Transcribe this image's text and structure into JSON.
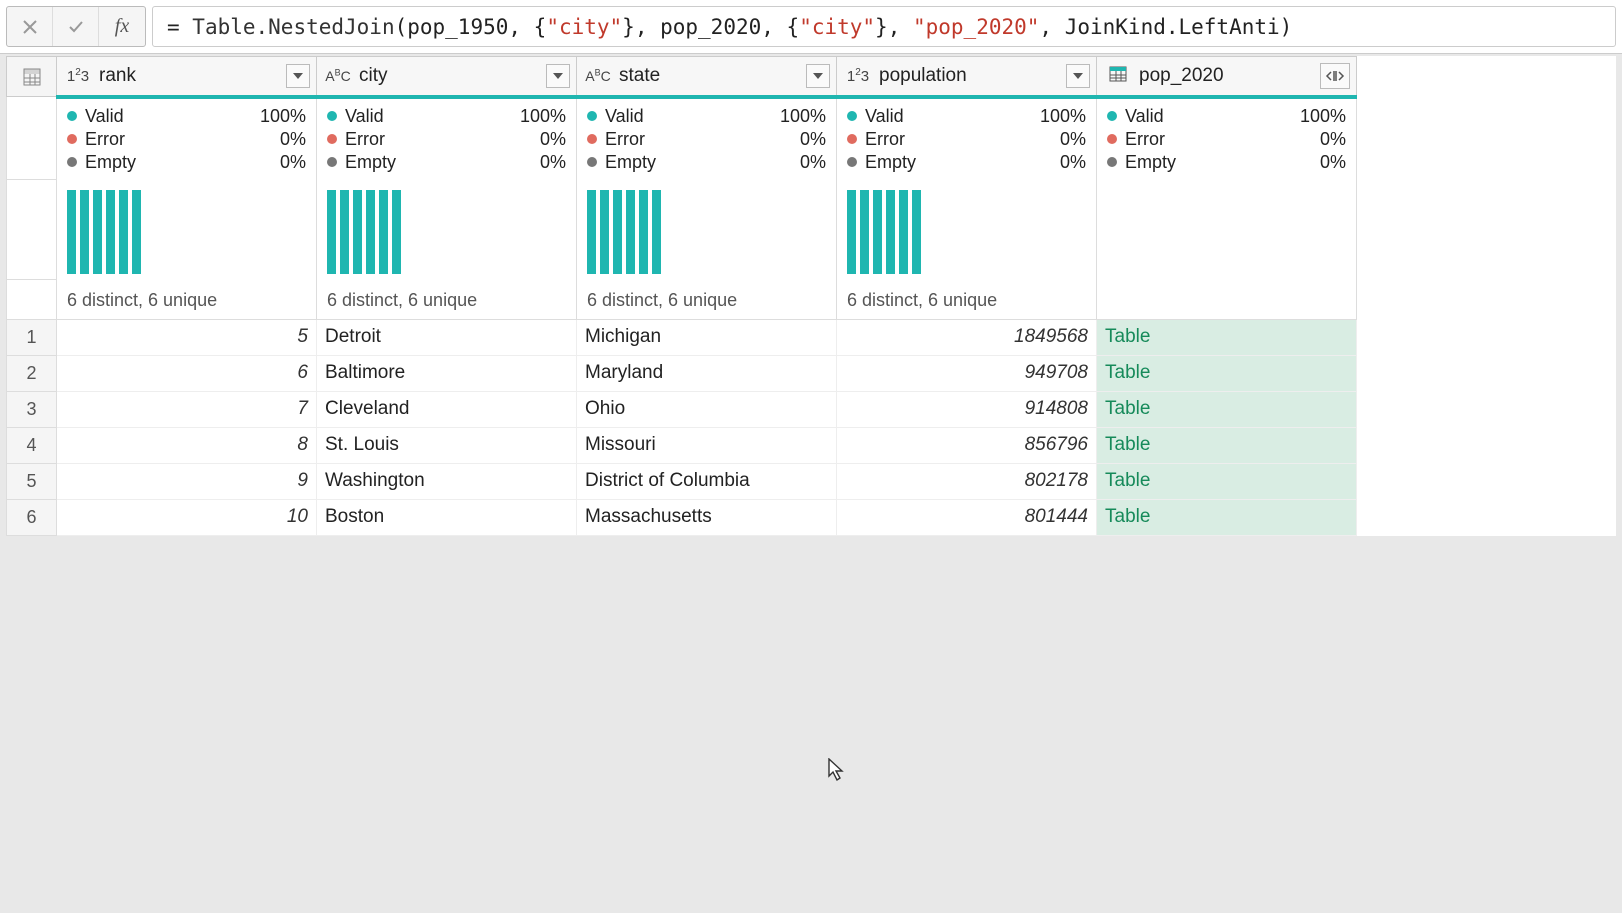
{
  "formula": {
    "tokens": [
      {
        "t": "plain",
        "v": "= "
      },
      {
        "t": "fn",
        "v": "Table.NestedJoin"
      },
      {
        "t": "plain",
        "v": "(pop_1950, {"
      },
      {
        "t": "str",
        "v": "\"city\""
      },
      {
        "t": "plain",
        "v": "}, pop_2020, {"
      },
      {
        "t": "str",
        "v": "\"city\""
      },
      {
        "t": "plain",
        "v": "}, "
      },
      {
        "t": "str",
        "v": "\"pop_2020\""
      },
      {
        "t": "plain",
        "v": ", JoinKind.LeftAnti)"
      }
    ]
  },
  "columns": [
    {
      "name": "rank",
      "type": "num",
      "quality": {
        "valid": "100%",
        "error": "0%",
        "empty": "0%"
      },
      "distinct": "6 distinct, 6 unique",
      "align": "num",
      "has_hist": true
    },
    {
      "name": "city",
      "type": "text",
      "quality": {
        "valid": "100%",
        "error": "0%",
        "empty": "0%"
      },
      "distinct": "6 distinct, 6 unique",
      "align": "txt",
      "has_hist": true
    },
    {
      "name": "state",
      "type": "text",
      "quality": {
        "valid": "100%",
        "error": "0%",
        "empty": "0%"
      },
      "distinct": "6 distinct, 6 unique",
      "align": "txt",
      "has_hist": true
    },
    {
      "name": "population",
      "type": "num",
      "quality": {
        "valid": "100%",
        "error": "0%",
        "empty": "0%"
      },
      "distinct": "6 distinct, 6 unique",
      "align": "num",
      "has_hist": true
    },
    {
      "name": "pop_2020",
      "type": "table",
      "quality": {
        "valid": "100%",
        "error": "0%",
        "empty": "0%"
      },
      "distinct": "",
      "align": "link",
      "has_hist": false
    }
  ],
  "labels": {
    "valid": "Valid",
    "error": "Error",
    "empty": "Empty"
  },
  "rows": [
    {
      "n": "1",
      "cells": [
        "5",
        "Detroit",
        "Michigan",
        "1849568",
        "Table"
      ]
    },
    {
      "n": "2",
      "cells": [
        "6",
        "Baltimore",
        "Maryland",
        "949708",
        "Table"
      ]
    },
    {
      "n": "3",
      "cells": [
        "7",
        "Cleveland",
        "Ohio",
        "914808",
        "Table"
      ]
    },
    {
      "n": "4",
      "cells": [
        "8",
        "St. Louis",
        "Missouri",
        "856796",
        "Table"
      ]
    },
    {
      "n": "5",
      "cells": [
        "9",
        "Washington",
        "District of Columbia",
        "802178",
        "Table"
      ]
    },
    {
      "n": "6",
      "cells": [
        "10",
        "Boston",
        "Massachusetts",
        "801444",
        "Table"
      ]
    }
  ],
  "type_icons": {
    "num": "1²3",
    "text": "AᴮC",
    "table": "▦"
  }
}
